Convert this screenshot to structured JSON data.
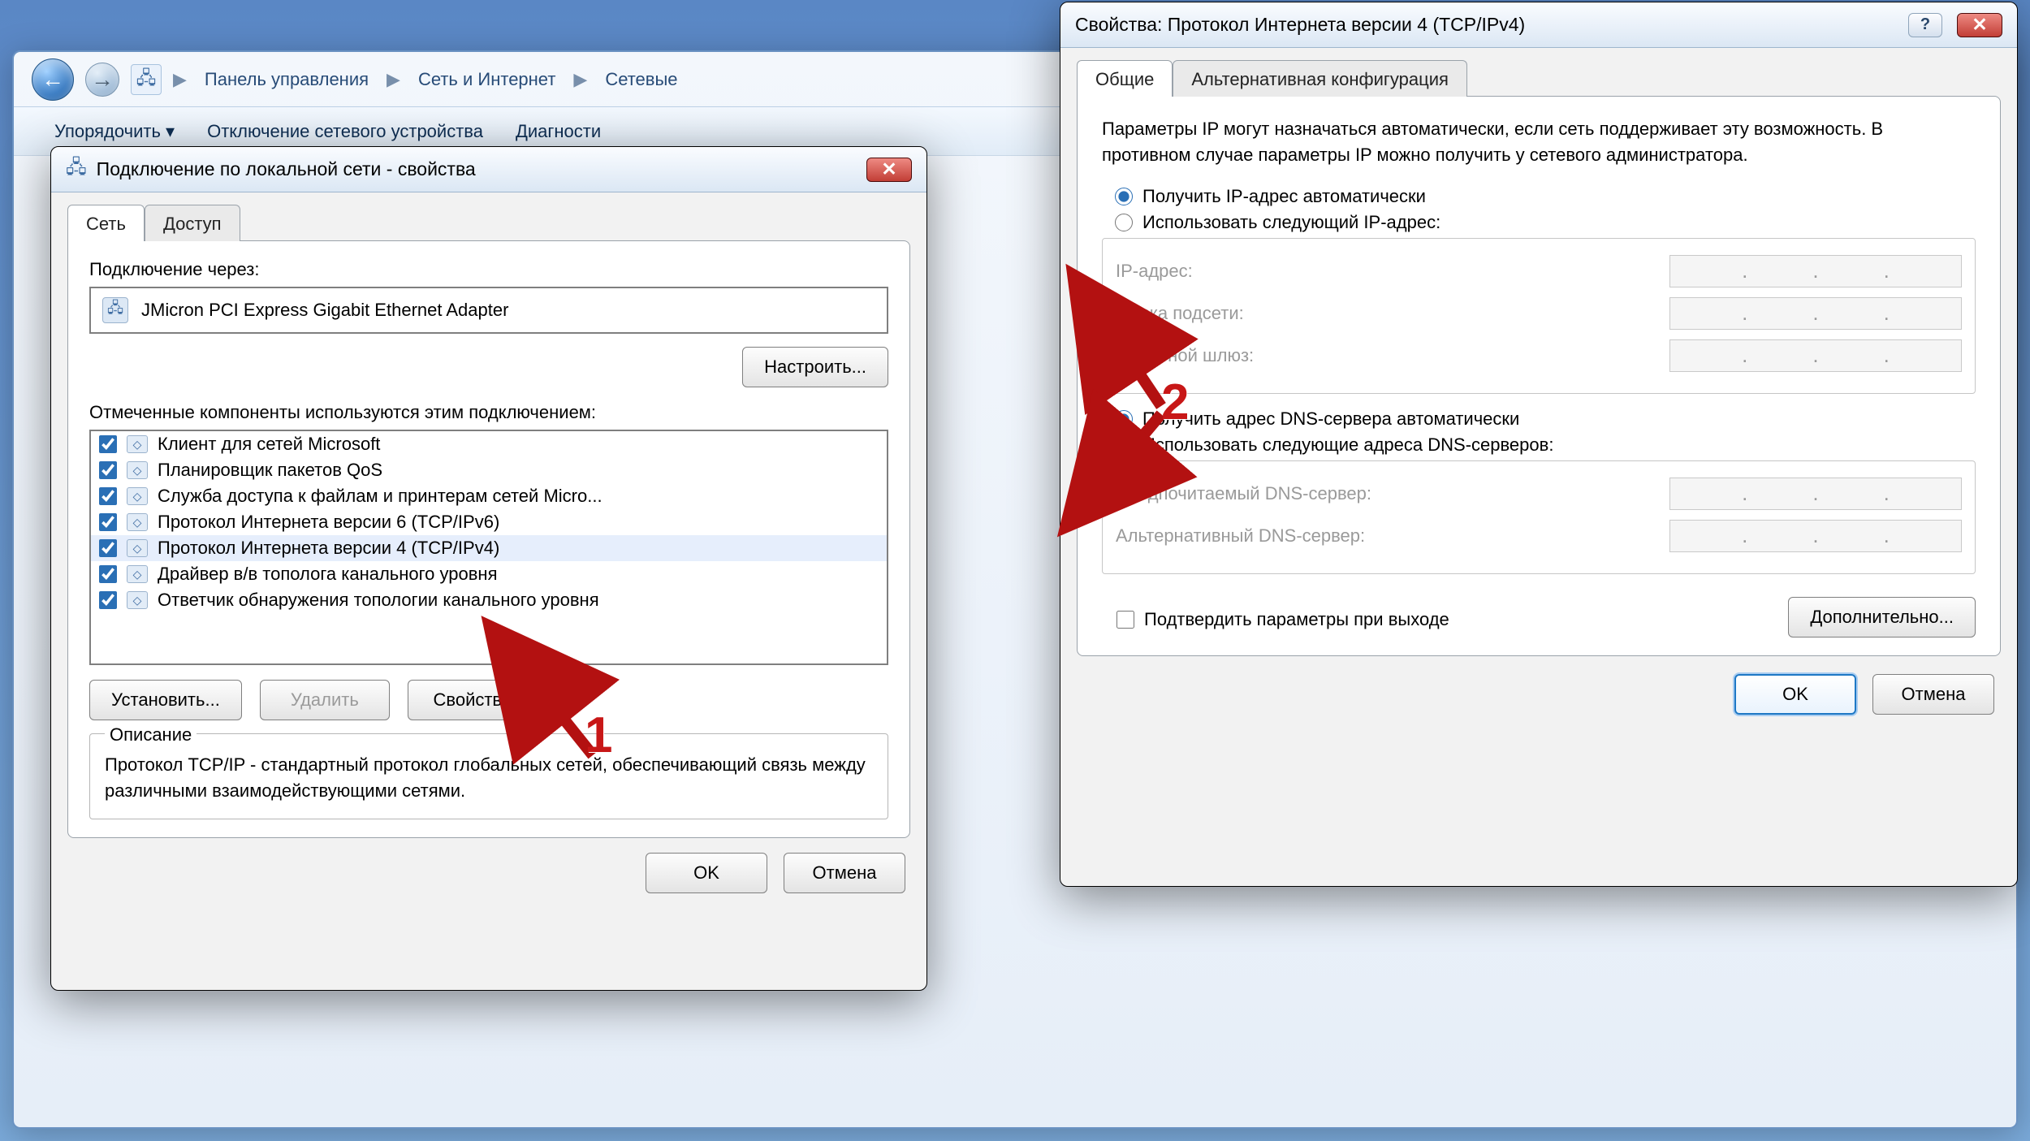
{
  "explorer": {
    "breadcrumbs": [
      "Панель управления",
      "Сеть и Интернет",
      "Сетевые"
    ],
    "toolbar": [
      "Упорядочить ▾",
      "Отключение сетевого устройства",
      "Диагности"
    ]
  },
  "leftDialog": {
    "title": "Подключение по локальной сети - свойства",
    "tabs": {
      "tab1": "Сеть",
      "tab2": "Доступ"
    },
    "connectThrough": "Подключение через:",
    "adapter": "JMicron PCI Express Gigabit Ethernet Adapter",
    "configure": "Настроить...",
    "componentsLabel": "Отмеченные компоненты используются этим подключением:",
    "components": [
      {
        "label": "Клиент для сетей Microsoft",
        "checked": true,
        "selected": false
      },
      {
        "label": "Планировщик пакетов QoS",
        "checked": true,
        "selected": false
      },
      {
        "label": "Служба доступа к файлам и принтерам сетей Micro...",
        "checked": true,
        "selected": false
      },
      {
        "label": "Протокол Интернета версии 6 (TCP/IPv6)",
        "checked": true,
        "selected": false
      },
      {
        "label": "Протокол Интернета версии 4 (TCP/IPv4)",
        "checked": true,
        "selected": true
      },
      {
        "label": "Драйвер в/в тополога канального уровня",
        "checked": true,
        "selected": false
      },
      {
        "label": "Ответчик обнаружения топологии канального уровня",
        "checked": true,
        "selected": false
      }
    ],
    "buttons": {
      "install": "Установить...",
      "remove": "Удалить",
      "properties": "Свойства"
    },
    "descriptionLabel": "Описание",
    "descriptionBody": "Протокол TCP/IP - стандартный протокол глобальных сетей, обеспечивающий связь между различными взаимодействующими сетями.",
    "ok": "OK",
    "cancel": "Отмена"
  },
  "rightDialog": {
    "title": "Свойства: Протокол Интернета версии 4 (TCP/IPv4)",
    "tabs": {
      "tab1": "Общие",
      "tab2": "Альтернативная конфигурация"
    },
    "info": "Параметры IP могут назначаться автоматически, если сеть поддерживает эту возможность. В противном случае параметры IP можно получить у сетевого администратора.",
    "radios": {
      "autoIp": "Получить IP-адрес автоматически",
      "manualIp": "Использовать следующий IP-адрес:",
      "autoDns": "Получить адрес DNS-сервера автоматически",
      "manualDns": "Использовать следующие адреса DNS-серверов:"
    },
    "fields": {
      "ip": "IP-адрес:",
      "mask": "Маска подсети:",
      "gateway": "Основной шлюз:",
      "dns1": "Предпочитаемый DNS-сервер:",
      "dns2": "Альтернативный DNS-сервер:"
    },
    "confirmExit": "Подтвердить параметры при выходе",
    "advanced": "Дополнительно...",
    "ok": "OK",
    "cancel": "Отмена"
  },
  "annotations": {
    "num1": "1",
    "num2": "2"
  }
}
